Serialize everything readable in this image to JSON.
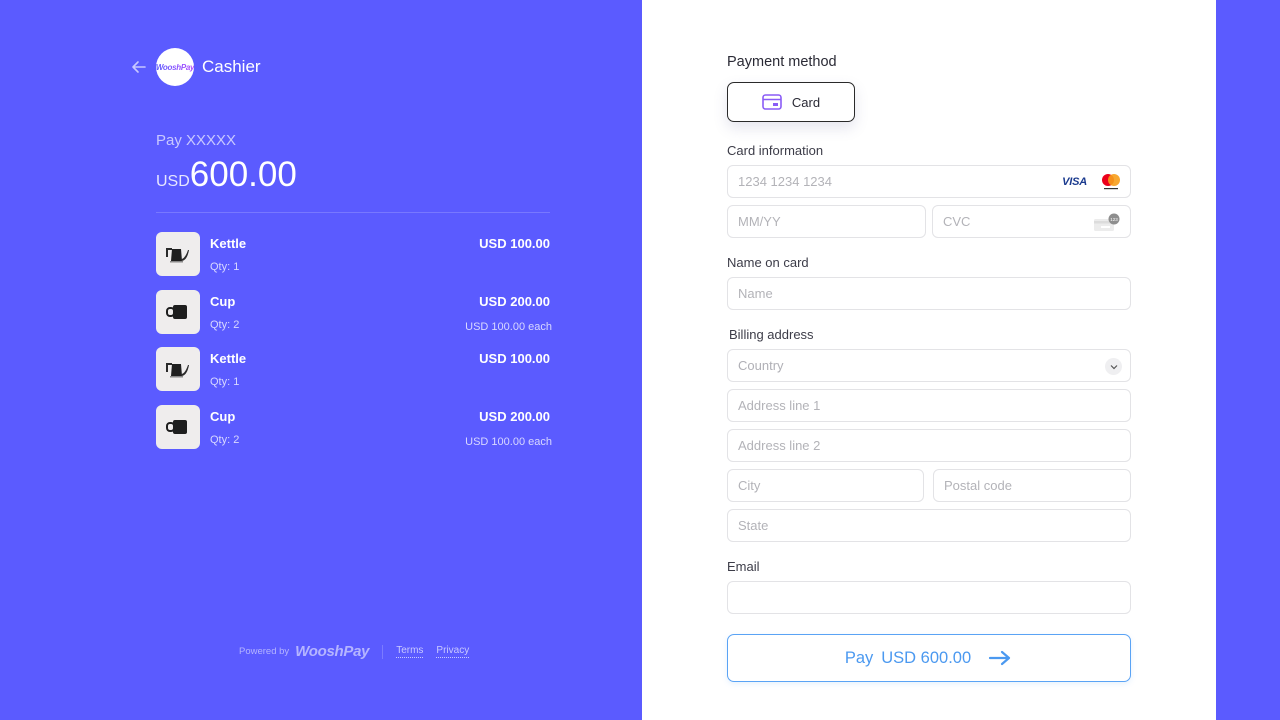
{
  "colors": {
    "brand": "#5b5bff",
    "pay_button": "#4b99f0",
    "visa_blue": "#1a3a8e",
    "mastercard_red": "#eb001b",
    "mastercard_orange": "#f79e1b"
  },
  "header": {
    "back_icon": "arrow-left-icon",
    "logo_text": "WooshPay",
    "title": "Cashier"
  },
  "summary": {
    "pay_label": "Pay XXXXX",
    "currency": "USD",
    "amount": "600.00"
  },
  "items": [
    {
      "name": "Kettle",
      "qty": "Qty: 1",
      "price": "USD 100.00",
      "each": "",
      "image": "kettle"
    },
    {
      "name": "Cup",
      "qty": "Qty: 2",
      "price": "USD 200.00",
      "each": "USD 100.00 each",
      "image": "cup"
    },
    {
      "name": "Kettle",
      "qty": "Qty: 1",
      "price": "USD 100.00",
      "each": "",
      "image": "kettle"
    },
    {
      "name": "Cup",
      "qty": "Qty: 2",
      "price": "USD 200.00",
      "each": "USD 100.00 each",
      "image": "cup"
    }
  ],
  "footer": {
    "powered_by": "Powered by",
    "brand": "WooshPay",
    "terms": "Terms",
    "privacy": "Privacy"
  },
  "form": {
    "payment_method_label": "Payment method",
    "method_card_label": "Card",
    "card_info_label": "Card information",
    "card_number_placeholder": "1234 1234 1234",
    "card_number_value": "",
    "visa_label": "VISA",
    "expiry_placeholder": "MM/YY",
    "expiry_value": "",
    "cvc_placeholder": "CVC",
    "cvc_value": "",
    "cvc_badge": "123",
    "name_label": "Name on card",
    "name_placeholder": "Name",
    "name_value": "",
    "billing_label": "Billing address",
    "country_placeholder": "Country",
    "address1_placeholder": "Address line 1",
    "address2_placeholder": "Address line 2",
    "city_placeholder": "City",
    "postal_placeholder": "Postal code",
    "state_placeholder": "State",
    "email_label": "Email",
    "email_placeholder": "",
    "email_value": "",
    "pay_button_prefix": "Pay",
    "pay_button_amount": "USD 600.00"
  }
}
